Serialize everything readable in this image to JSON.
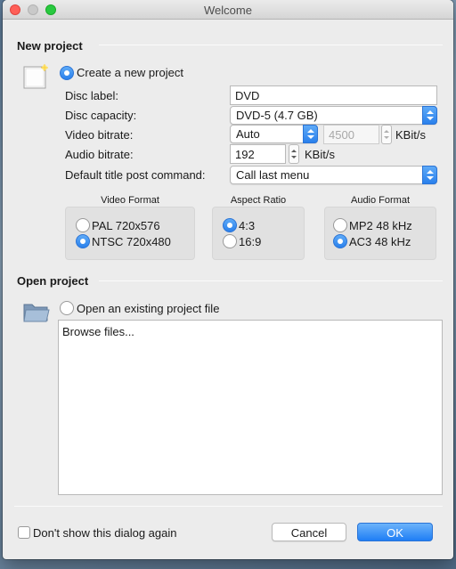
{
  "window": {
    "title": "Welcome"
  },
  "new_project": {
    "section_title": "New project",
    "create_label": "Create a new project",
    "create_selected": true,
    "disc_label": {
      "label": "Disc label:",
      "value": "DVD"
    },
    "disc_capacity": {
      "label": "Disc capacity:",
      "value": "DVD-5 (4.7 GB)"
    },
    "video_bitrate": {
      "label": "Video bitrate:",
      "mode": "Auto",
      "value": "4500",
      "unit": "KBit/s"
    },
    "audio_bitrate": {
      "label": "Audio bitrate:",
      "value": "192",
      "unit": "KBit/s"
    },
    "title_post_command": {
      "label": "Default title post command:",
      "value": "Call last menu"
    },
    "video_format": {
      "title": "Video Format",
      "options": [
        {
          "label": "PAL 720x576",
          "selected": false
        },
        {
          "label": "NTSC 720x480",
          "selected": true
        }
      ]
    },
    "aspect_ratio": {
      "title": "Aspect Ratio",
      "options": [
        {
          "label": "4:3",
          "selected": true
        },
        {
          "label": "16:9",
          "selected": false
        }
      ]
    },
    "audio_format": {
      "title": "Audio Format",
      "options": [
        {
          "label": "MP2 48 kHz",
          "selected": false
        },
        {
          "label": "AC3 48 kHz",
          "selected": true
        }
      ]
    }
  },
  "open_project": {
    "section_title": "Open project",
    "open_label": "Open an existing project file",
    "open_selected": false,
    "browse_text": "Browse files..."
  },
  "footer": {
    "dont_show_label": "Don't show this dialog again",
    "dont_show_checked": false,
    "cancel_label": "Cancel",
    "ok_label": "OK"
  },
  "icons": {
    "new_project": "new-document-icon",
    "open_project": "folder-icon"
  },
  "colors": {
    "accent": "#2a80ec",
    "window_bg": "#ececec"
  }
}
